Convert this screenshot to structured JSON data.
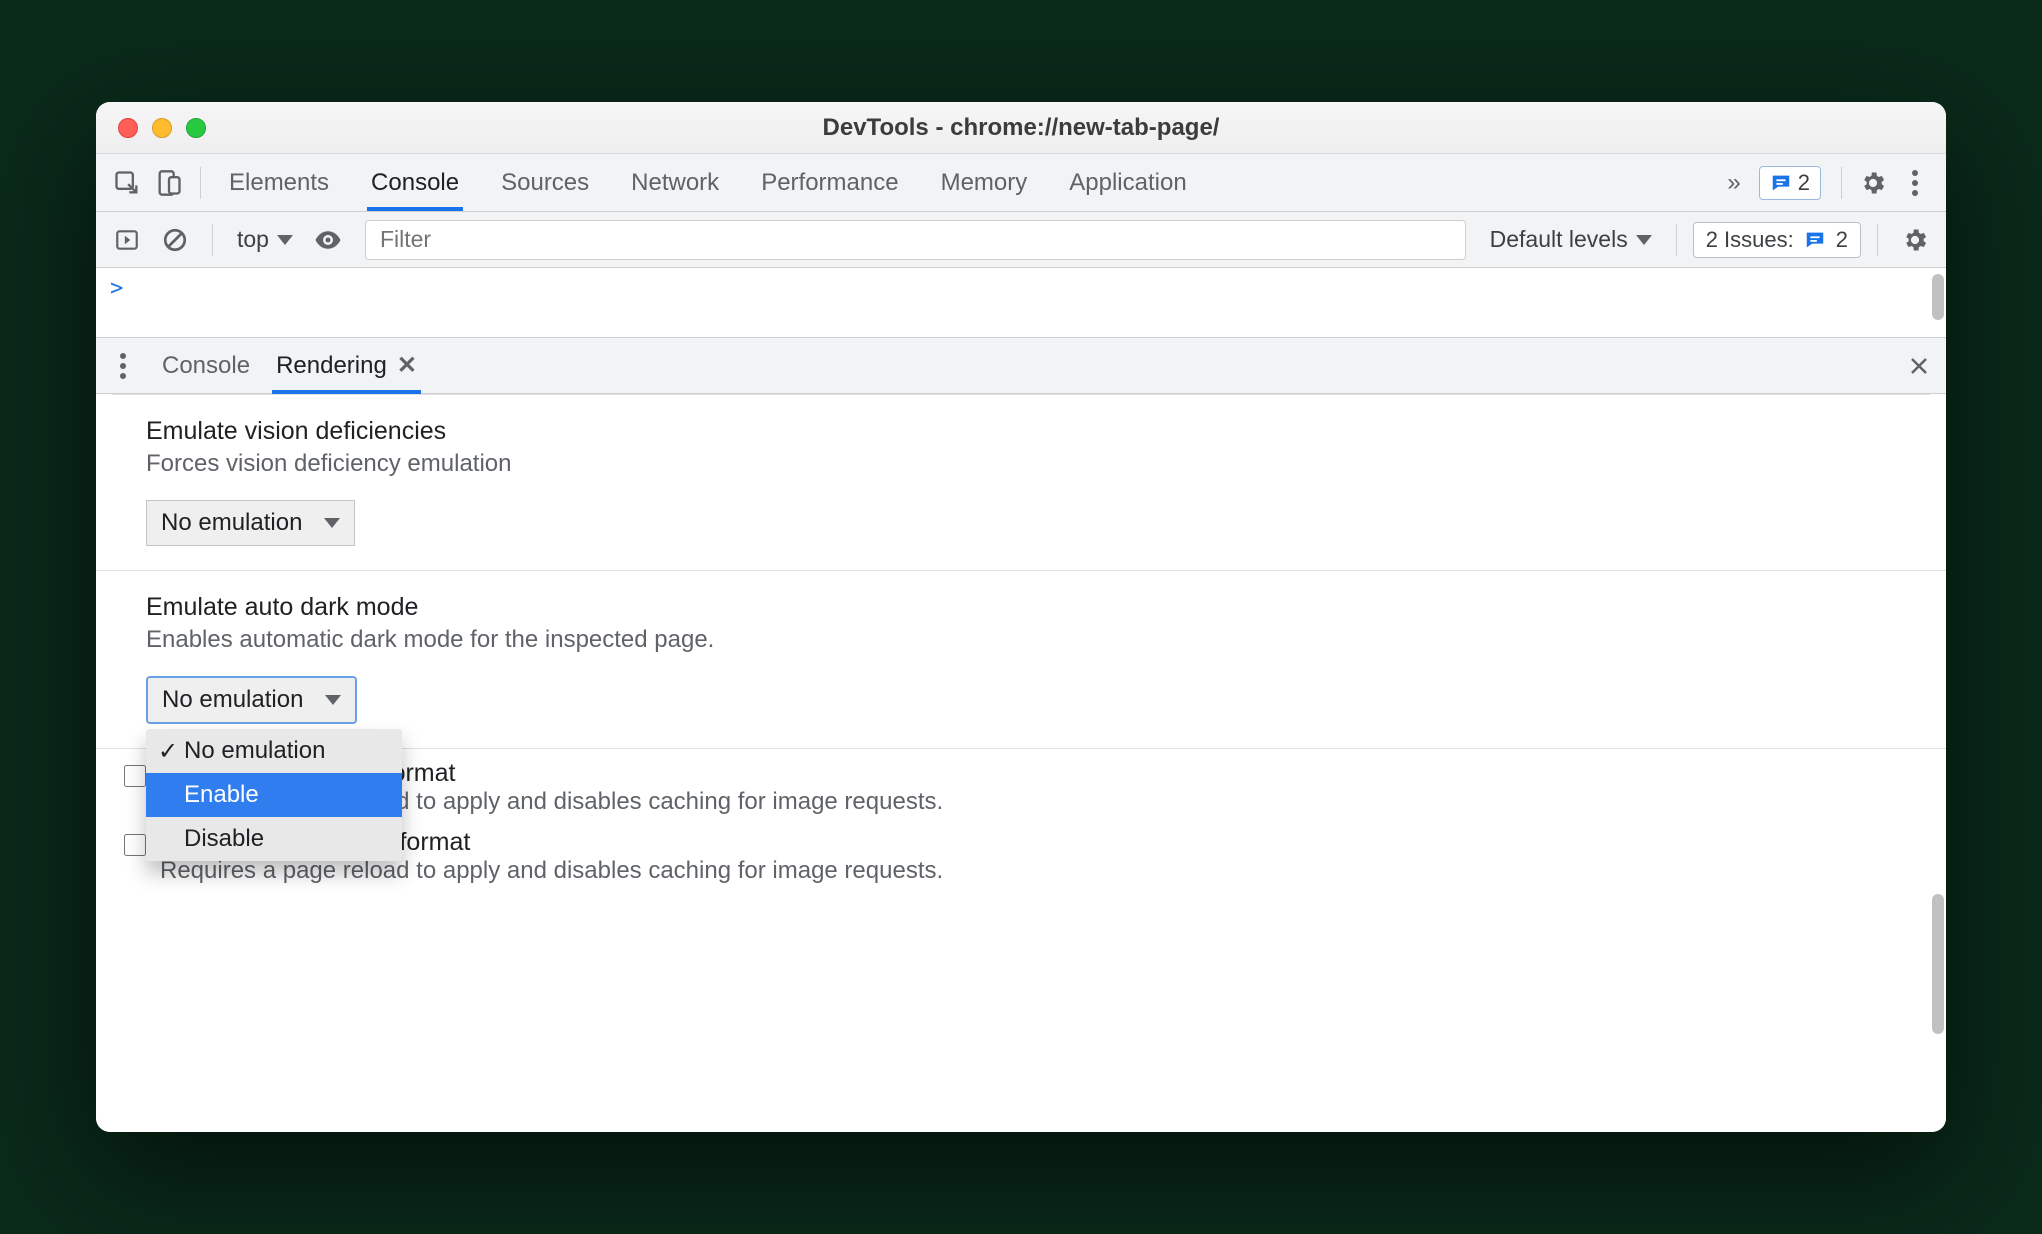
{
  "window": {
    "title": "DevTools - chrome://new-tab-page/"
  },
  "tabs": {
    "items": [
      "Elements",
      "Console",
      "Sources",
      "Network",
      "Performance",
      "Memory",
      "Application"
    ],
    "active_index": 1
  },
  "toolbar_right": {
    "messages_badge_count": "2"
  },
  "console_bar": {
    "context_label": "top",
    "filter_placeholder": "Filter",
    "levels_label": "Default levels",
    "issues_text": "2 Issues:",
    "issues_count": "2"
  },
  "console_prompt": {
    "chevron": ">"
  },
  "drawer": {
    "tabs": [
      {
        "label": "Console",
        "active": false,
        "closable": false
      },
      {
        "label": "Rendering",
        "active": true,
        "closable": true
      }
    ]
  },
  "rendering": {
    "vision": {
      "title": "Emulate vision deficiencies",
      "desc": "Forces vision deficiency emulation",
      "select": "No emulation"
    },
    "autodark": {
      "title": "Emulate auto dark mode",
      "desc": "Enables automatic dark mode for the inspected page.",
      "select": "No emulation",
      "options": [
        "No emulation",
        "Enable",
        "Disable"
      ],
      "selected_index": 0,
      "hover_index": 1
    },
    "avif": {
      "title": "Disable AVIF image format",
      "desc": "Requires a page reload to apply and disables caching for image requests."
    },
    "webp": {
      "title": "Disable WebP image format",
      "desc": "Requires a page reload to apply and disables caching for image requests."
    }
  }
}
